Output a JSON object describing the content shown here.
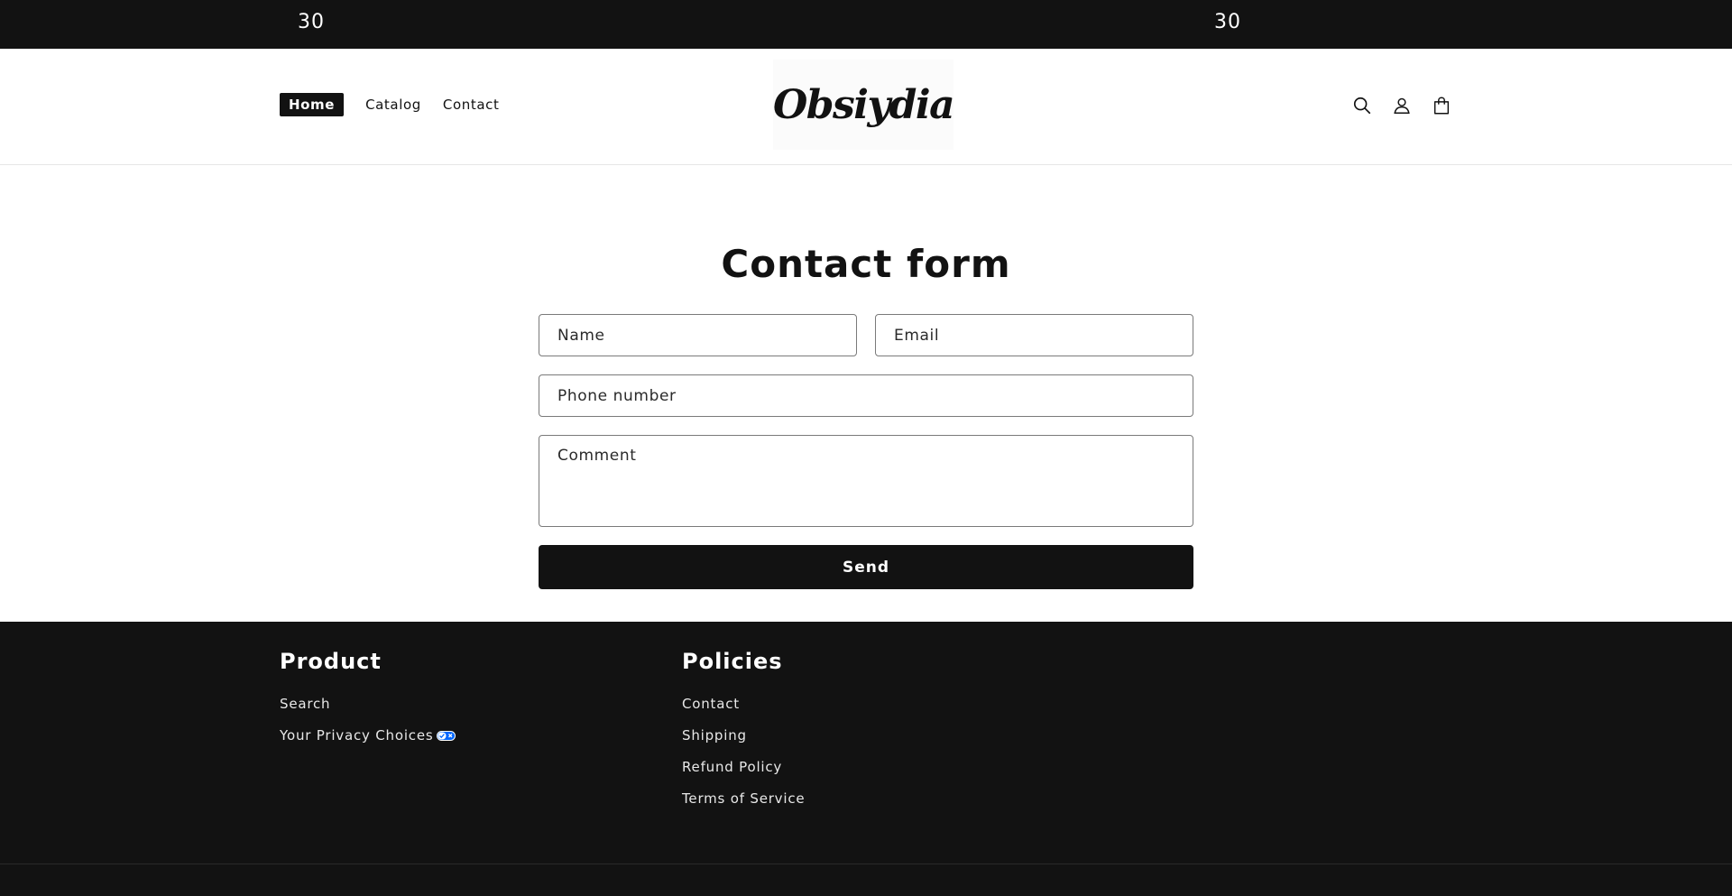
{
  "announcement": {
    "left_text": "30",
    "right_text": "30"
  },
  "header": {
    "nav": [
      {
        "label": "Home",
        "active": true
      },
      {
        "label": "Catalog",
        "active": false
      },
      {
        "label": "Contact",
        "active": false
      }
    ],
    "logo_text": "Obsiydia",
    "icons": [
      "search-icon",
      "account-icon",
      "cart-icon"
    ]
  },
  "main": {
    "title": "Contact form",
    "form": {
      "name_placeholder": "Name",
      "email_placeholder": "Email",
      "phone_placeholder": "Phone number",
      "comment_placeholder": "Comment",
      "send_label": "Send"
    }
  },
  "footer": {
    "columns": [
      {
        "heading": "Product",
        "links": [
          "Search",
          "Your Privacy Choices"
        ]
      },
      {
        "heading": "Policies",
        "links": [
          "Contact",
          "Shipping",
          "Refund Policy",
          "Terms of Service"
        ]
      }
    ]
  },
  "colors": {
    "dark": "#121212",
    "white": "#ffffff",
    "privacy_blue": "#0066ff"
  }
}
